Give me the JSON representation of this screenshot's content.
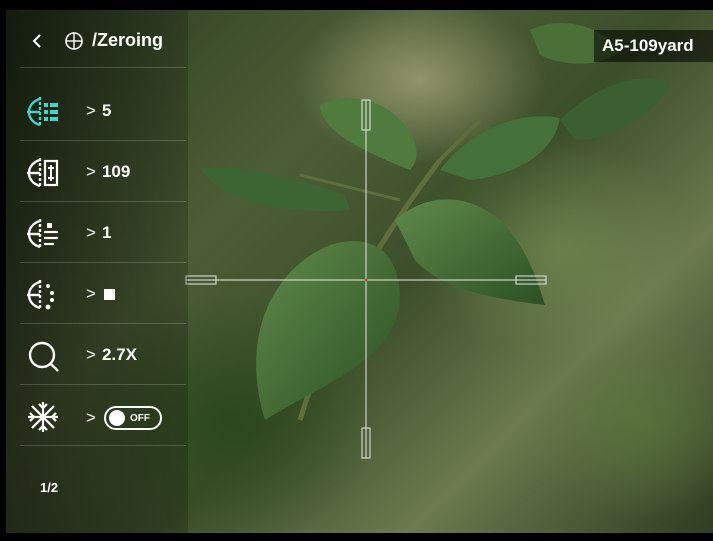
{
  "header": {
    "back_icon": "chevron-left-icon",
    "target_icon": "crosshair-target-icon",
    "title": "/Zeroing"
  },
  "badge": {
    "text": "A5-109yard"
  },
  "menu": {
    "active_color": "#3fd6c8",
    "items": [
      {
        "icon": "zeroing-profile-icon",
        "value": "5"
      },
      {
        "icon": "zeroing-distance-icon",
        "value": "109"
      },
      {
        "icon": "reticle-style-icon",
        "value": "1"
      },
      {
        "icon": "reticle-color-icon",
        "value": ""
      },
      {
        "icon": "zoom-icon",
        "value": "2.7X"
      },
      {
        "icon": "freeze-icon",
        "value": ""
      }
    ],
    "freeze_toggle": {
      "label": "OFF",
      "state": "off"
    },
    "page_indicator": "1/2"
  }
}
